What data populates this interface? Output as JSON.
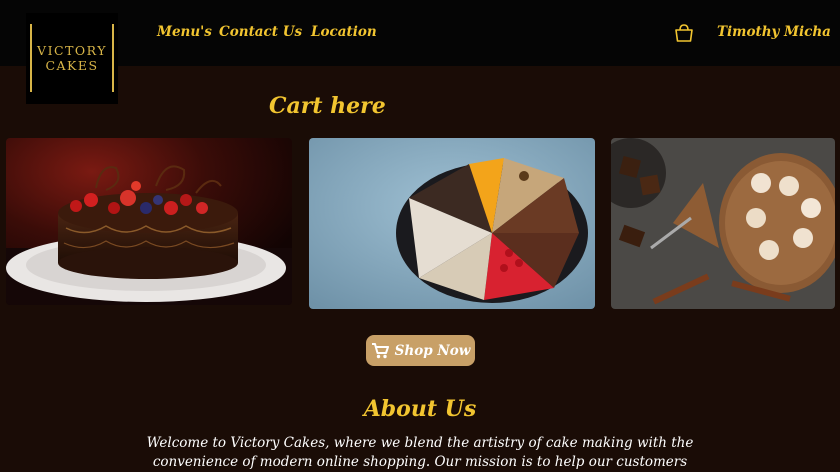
{
  "brand": {
    "logo_line1": "VICTORY",
    "logo_line2": "CAKES"
  },
  "nav": {
    "menu": "Menu's",
    "contact": "Contact Us",
    "location": "Location"
  },
  "user": {
    "name": "Timothy Micha"
  },
  "cart": {
    "title": "Cart here"
  },
  "gallery": {
    "items": [
      {
        "subject": "chocolate cake with berries"
      },
      {
        "subject": "assorted cake slices"
      },
      {
        "subject": "chocolate tart and meringues"
      }
    ]
  },
  "shop_button": {
    "label": "Shop Now",
    "icon": "shopping-cart-icon"
  },
  "about": {
    "title": "About Us",
    "text": "Welcome to Victory Cakes, where we blend the artistry of cake making with the convenience of modern online shopping. Our mission is to help our customers"
  },
  "colors": {
    "accent": "#f2c530",
    "background": "#1a0c06",
    "navbar": "#050505",
    "button": "#c8a067"
  }
}
